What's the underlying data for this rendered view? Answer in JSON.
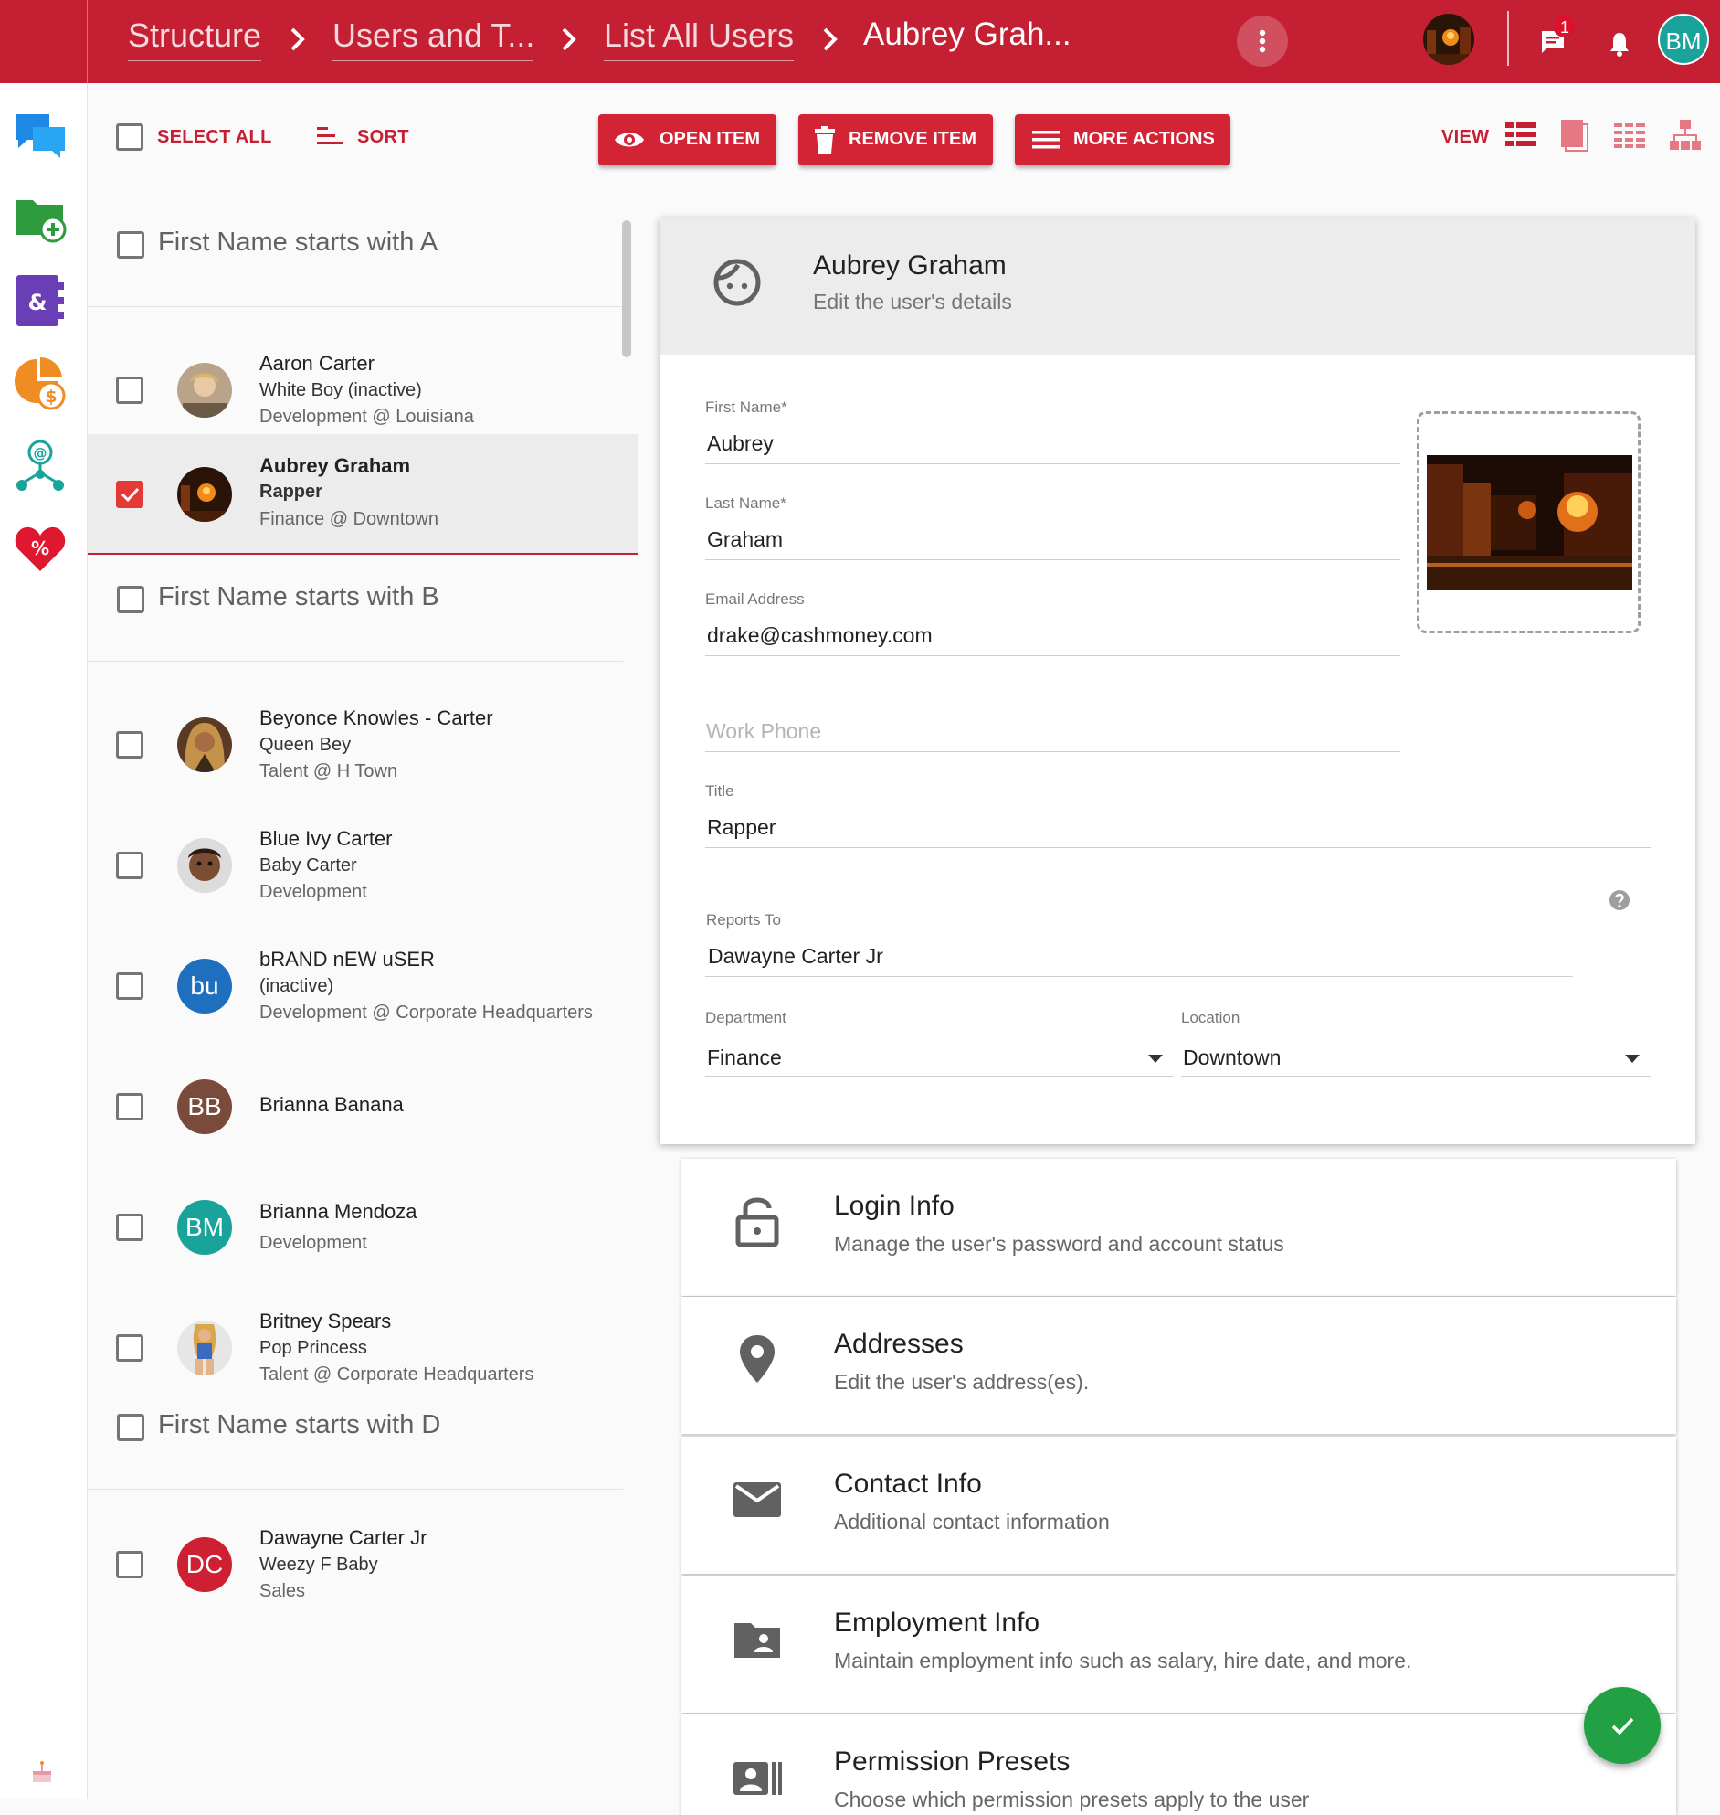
{
  "breadcrumb": [
    "Structure",
    "Users and T...",
    "List All Users",
    "Aubrey Grah..."
  ],
  "header": {
    "notification_count": "1",
    "user_initials": "BM"
  },
  "toolbar": {
    "select_all": "SELECT ALL",
    "sort": "SORT",
    "open_item": "OPEN ITEM",
    "remove_item": "REMOVE ITEM",
    "more_actions": "MORE ACTIONS",
    "view": "VIEW"
  },
  "list": {
    "groups": [
      "First Name starts with A",
      "First Name starts with B",
      "First Name starts with D"
    ],
    "users": [
      {
        "name": "Aaron Carter",
        "title": "White Boy (inactive)",
        "dept": "Development @ Louisiana"
      },
      {
        "name": "Aubrey Graham",
        "title": "Rapper",
        "dept": "Finance @ Downtown"
      },
      {
        "name": "Beyonce Knowles - Carter",
        "title": "Queen Bey",
        "dept": "Talent @ H Town"
      },
      {
        "name": "Blue Ivy Carter",
        "title": "Baby Carter",
        "dept": "Development"
      },
      {
        "name": "bRAND nEW uSER",
        "title": "(inactive)",
        "dept": "Development @ Corporate Headquarters",
        "initials": "bu"
      },
      {
        "name": "Brianna Banana",
        "initials": "BB"
      },
      {
        "name": "Brianna Mendoza",
        "dept": "Development",
        "initials": "BM"
      },
      {
        "name": "Britney Spears",
        "title": "Pop Princess",
        "dept": "Talent @ Corporate Headquarters"
      },
      {
        "name": "Dawayne Carter Jr",
        "title": "Weezy F Baby",
        "dept": "Sales",
        "initials": "DC"
      }
    ]
  },
  "detail": {
    "name": "Aubrey Graham",
    "subtitle": "Edit the user's details",
    "fields": {
      "first_name_label": "First Name",
      "first_name": "Aubrey",
      "last_name_label": "Last Name",
      "last_name": "Graham",
      "email_label": "Email Address",
      "email": "drake@cashmoney.com",
      "work_phone_placeholder": "Work Phone",
      "title_label": "Title",
      "title": "Rapper",
      "reports_to_label": "Reports To",
      "reports_to": "Dawayne Carter Jr",
      "department_label": "Department",
      "department": "Finance",
      "location_label": "Location",
      "location": "Downtown",
      "required_mark": "*"
    }
  },
  "sections": [
    {
      "title": "Login Info",
      "subtitle": "Manage the user's password and account status",
      "icon": "lock-icon"
    },
    {
      "title": "Addresses",
      "subtitle": "Edit the user's address(es).",
      "icon": "location-pin-icon"
    },
    {
      "title": "Contact Info",
      "subtitle": "Additional contact information",
      "icon": "envelope-icon"
    },
    {
      "title": "Employment Info",
      "subtitle": "Maintain employment info such as salary, hire date, and more.",
      "icon": "folder-user-icon"
    },
    {
      "title": "Permission Presets",
      "subtitle": "Choose which permission presets apply to the user",
      "icon": "id-card-icon"
    }
  ],
  "colors": {
    "brand": "#c41f32",
    "fab": "#21a144",
    "avatar_bu": "#1f6fbf",
    "avatar_bb": "#7a4b3a",
    "avatar_bm": "#1aa39a",
    "avatar_dc": "#cf1f33"
  }
}
